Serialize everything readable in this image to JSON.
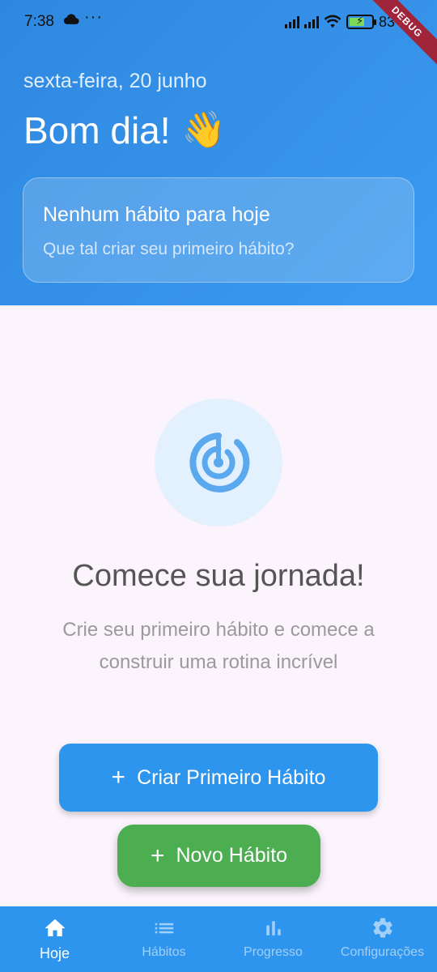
{
  "status_bar": {
    "time": "7:38",
    "dots": "···",
    "battery_pct": "83",
    "debug_label": "DEBUG"
  },
  "header": {
    "date": "sexta-feira, 20 junho",
    "greeting": "Bom dia!",
    "greeting_emoji": "👋",
    "summary_title": "Nenhum hábito para hoje",
    "summary_subtitle": "Que tal criar seu primeiro hábito?"
  },
  "empty_state": {
    "icon": "target-icon",
    "title": "Comece sua jornada!",
    "description": "Crie seu primeiro hábito e comece a construir uma rotina incrível",
    "primary_button": "Criar Primeiro Hábito"
  },
  "fab": {
    "label": "Novo Hábito"
  },
  "bottom_nav": {
    "items": [
      {
        "label": "Hoje",
        "icon": "home-icon",
        "active": true
      },
      {
        "label": "Hábitos",
        "icon": "list-icon",
        "active": false
      },
      {
        "label": "Progresso",
        "icon": "bar-chart-icon",
        "active": false
      },
      {
        "label": "Configurações",
        "icon": "gear-icon",
        "active": false
      }
    ]
  },
  "colors": {
    "primary": "#2e95ee",
    "fab": "#4cae50",
    "background": "#fbf4fc"
  }
}
